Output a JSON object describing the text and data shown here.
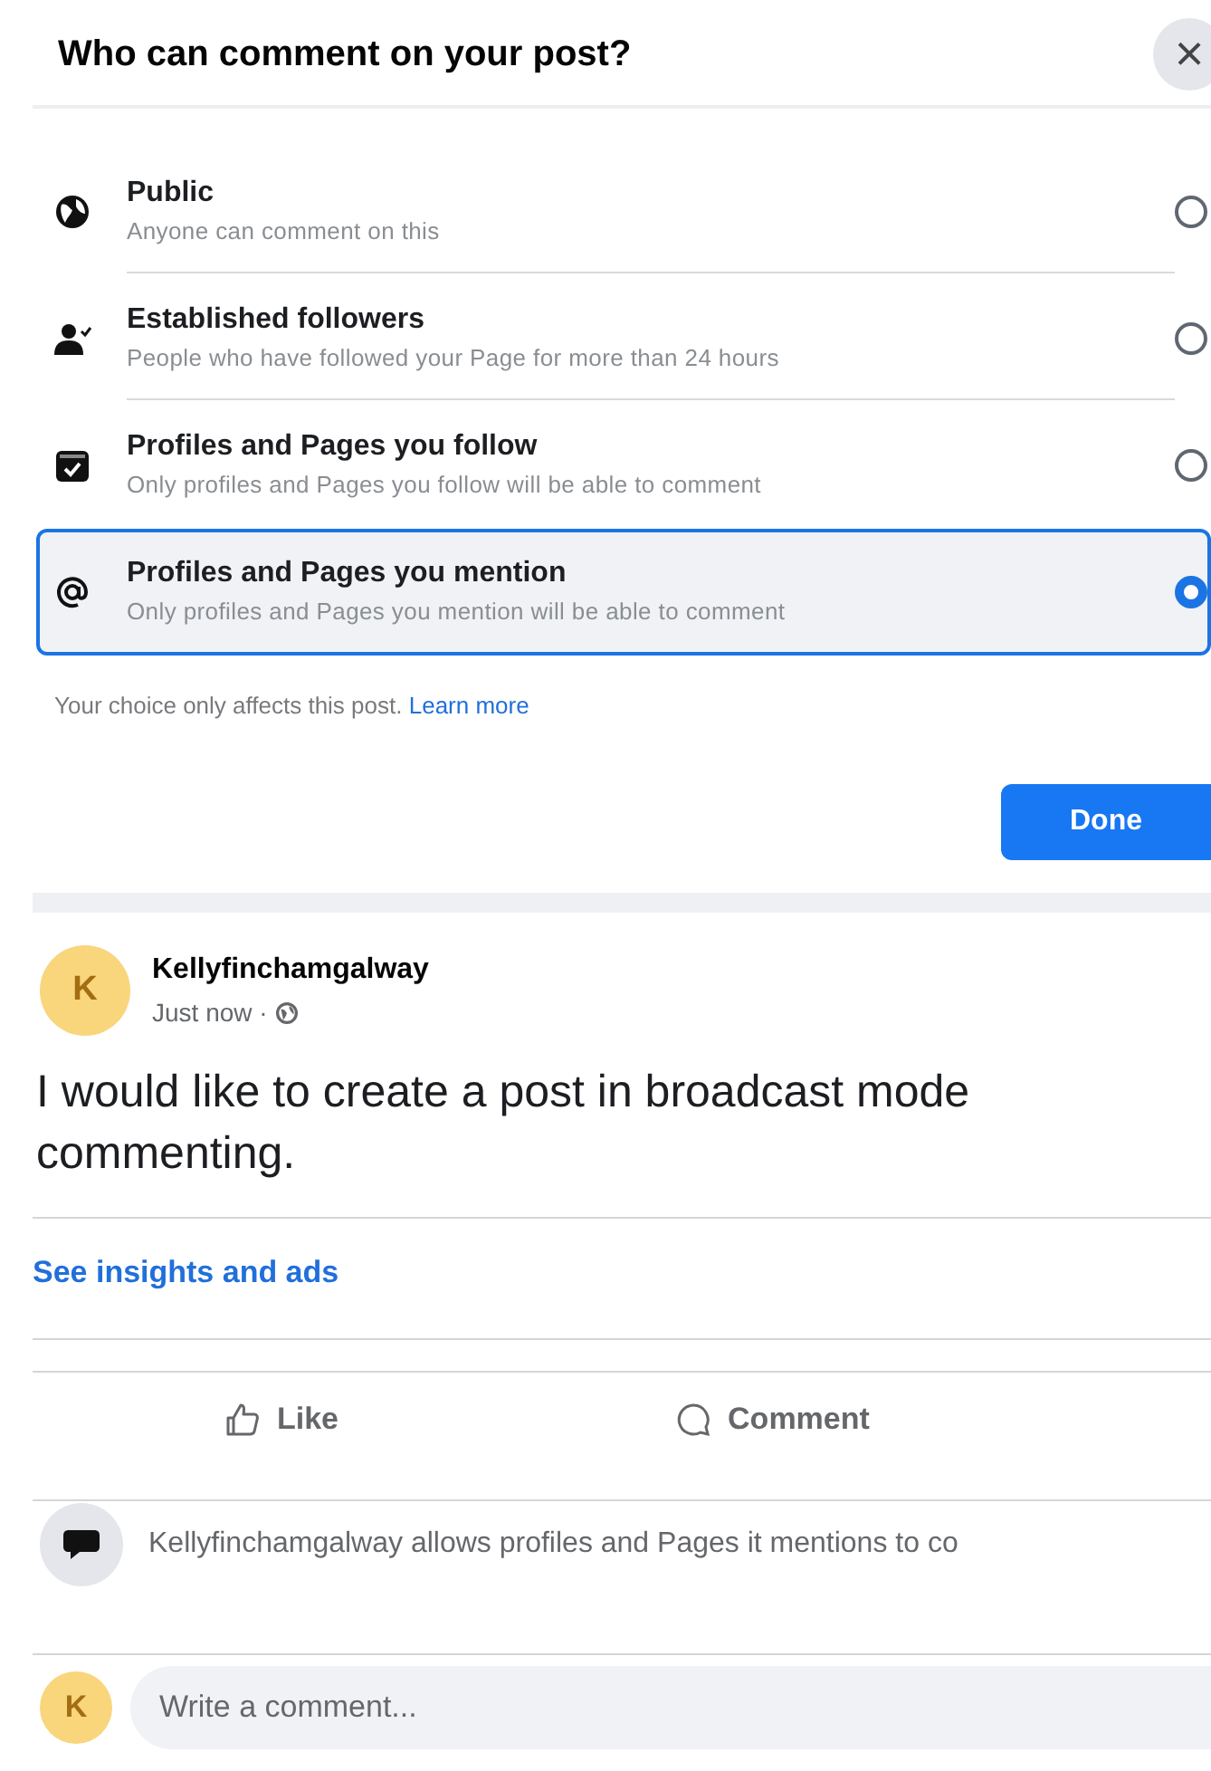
{
  "dialog": {
    "title": "Who can comment on your post?",
    "close": "×",
    "options": [
      {
        "kind": "globe",
        "label": "Public",
        "description": "Anyone can comment on this",
        "selected": false
      },
      {
        "kind": "person",
        "label": "Established followers",
        "description": "People who have followed your Page for more than 24 hours",
        "selected": false
      },
      {
        "kind": "check",
        "label": "Profiles and Pages you follow",
        "description": "Only profiles and Pages you follow will be able to comment",
        "selected": false
      },
      {
        "kind": "at",
        "label": "Profiles and Pages you mention",
        "description": "Only profiles and Pages you mention will be able to comment",
        "selected": true
      }
    ],
    "note": "Your choice only affects this post.",
    "note_link": "Learn more",
    "done": "Done"
  },
  "post": {
    "avatar": "K",
    "author": "Kellyfinchamgalway",
    "time": "Just now · ",
    "text": "I would like to create a post in broadcast mode\ncommenting.",
    "insights": "See insights and ads",
    "actions": [
      {
        "kind": "like",
        "label": "Like"
      },
      {
        "kind": "comment",
        "label": "Comment"
      }
    ],
    "notice": "Kellyfinchamgalway allows profiles and Pages it mentions to co",
    "comment_avatar": "K",
    "comment_placeholder": "Write a comment..."
  }
}
